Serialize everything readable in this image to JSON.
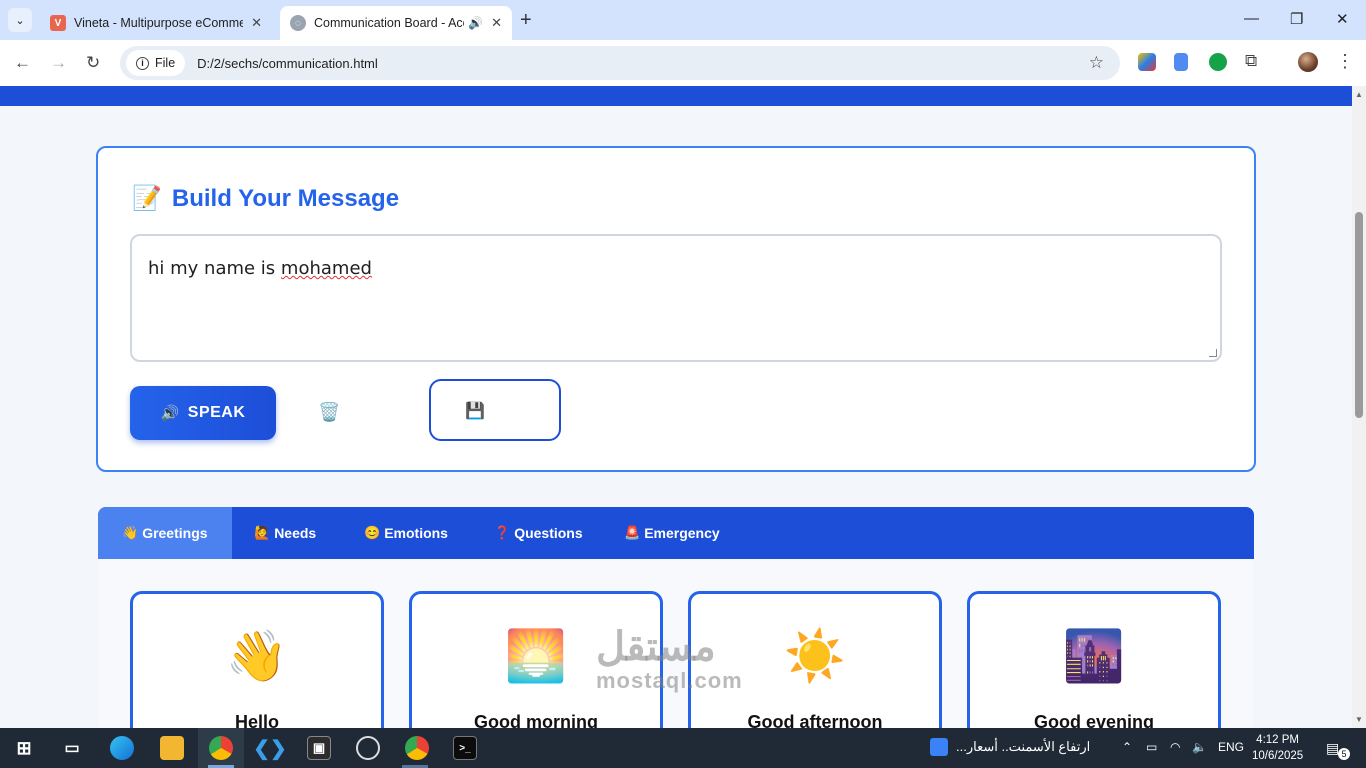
{
  "browser": {
    "tabs": [
      {
        "title": "Vineta - Multipurpose eComme",
        "favicon": "V"
      },
      {
        "title": "Communication Board - Acc"
      }
    ],
    "omnibox": {
      "chip_label": "File",
      "url": "D:/2/sechs/communication.html"
    }
  },
  "builder": {
    "title": "Build Your Message",
    "title_icon": "📝",
    "message_text": "hi my name is ",
    "message_misspelled": "mohamed",
    "speak_label": "SPEAK",
    "speak_icon": "🔊",
    "clear_icon": "🗑️",
    "save_icon": "💾"
  },
  "categories": [
    {
      "icon": "👋",
      "label": "Greetings"
    },
    {
      "icon": "🙋",
      "label": "Needs"
    },
    {
      "icon": "😊",
      "label": "Emotions"
    },
    {
      "icon": "❓",
      "label": "Questions"
    },
    {
      "icon": "🚨",
      "label": "Emergency"
    }
  ],
  "cards": [
    {
      "emoji": "👋",
      "label": "Hello"
    },
    {
      "emoji": "🌅",
      "label": "Good morning"
    },
    {
      "emoji": "☀️",
      "label": "Good afternoon"
    },
    {
      "emoji": "🌆",
      "label": "Good evening"
    }
  ],
  "watermark": {
    "arabic": "مستقل",
    "latin": "mostaql.com"
  },
  "taskbar": {
    "news": "ارتفاع الأسمنت.. أسعار...",
    "language": "ENG",
    "time": "4:12 PM",
    "date": "10/6/2025",
    "notifications": "5"
  },
  "colors": {
    "accent": "#2563eb",
    "band": "#1d4ed8",
    "active_tab": "#4c82f0"
  }
}
